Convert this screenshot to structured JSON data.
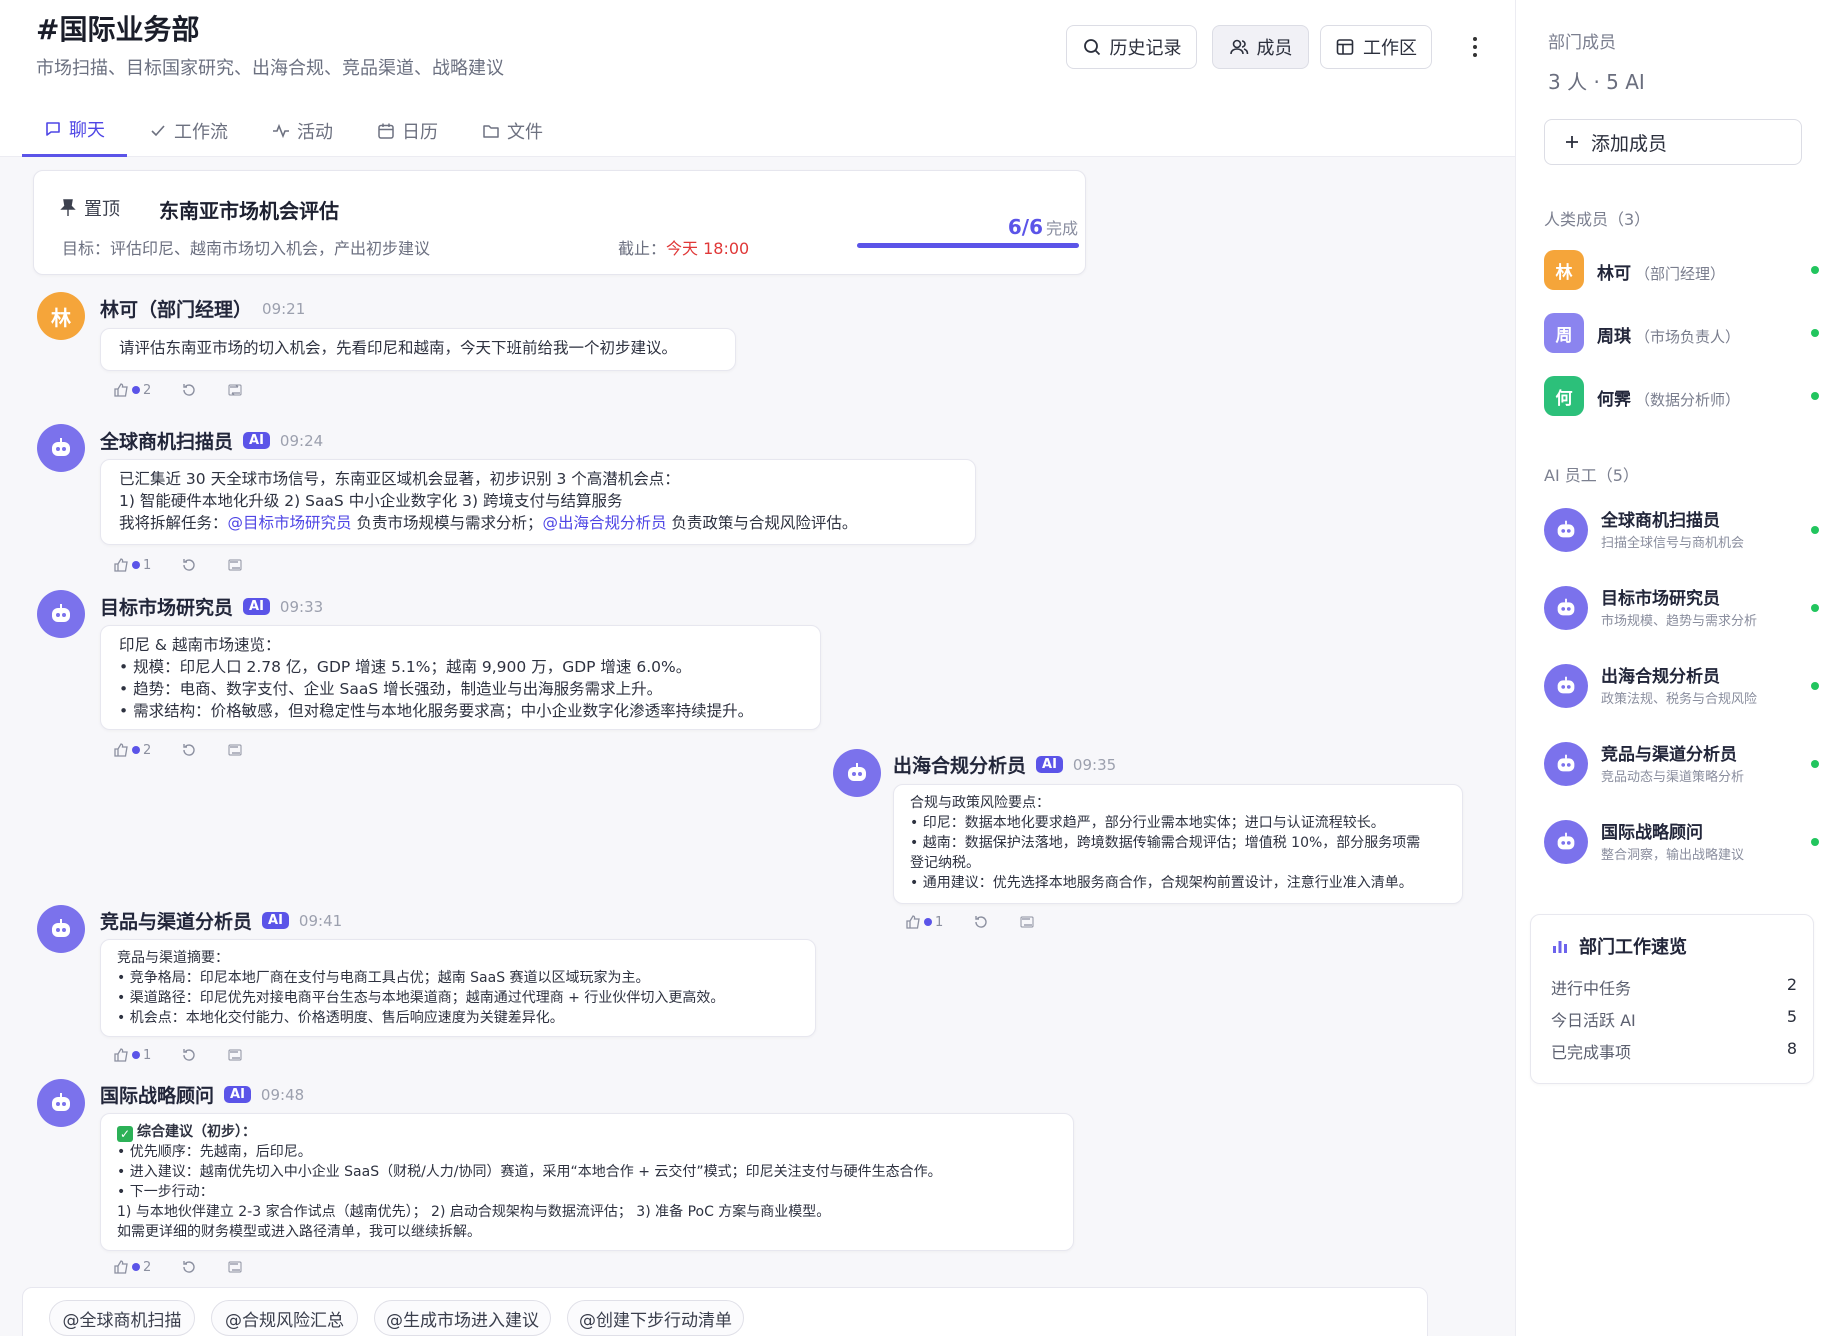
{
  "header": {
    "title": "#国际业务部",
    "desc": "市场扫描、目标国家研究、出海合规、竞品渠道、战略建议",
    "btn_history": "历史记录",
    "btn_members": "成员",
    "btn_workspace": "工作区"
  },
  "tabs": [
    "聊天",
    "工作流",
    "活动",
    "日历",
    "文件"
  ],
  "pinned": {
    "label": "置顶",
    "title": "东南亚市场机会评估",
    "goal": "目标：评估印尼、越南市场切入机会，产出初步建议",
    "deadline_label": "截止：",
    "deadline_value": "今天 18:00",
    "progress": "6/6",
    "progress_suffix": "完成",
    "progress_fraction": 1.0
  },
  "messages": [
    {
      "name": "林可",
      "role": "（部门经理）",
      "time": "09:21",
      "avatar": "林",
      "lines": [
        "请评估东南亚市场的切入机会，先看印尼和越南，今天下班前给我一个初步建议。"
      ],
      "likes": "2"
    },
    {
      "name": "全球商机扫描员",
      "ai": "AI",
      "time": "09:24",
      "line1": "已汇集近 30 天全球市场信号，东南亚区域机会显著，初步识别 3 个高潜机会点：",
      "line2": "1) 智能硬件本地化升级    2) SaaS 中小企业数字化    3) 跨境支付与结算服务",
      "line3_a": "我将拆解任务：",
      "line3_m1": "@目标市场研究员",
      "line3_b": " 负责市场规模与需求分析；",
      "line3_m2": "@出海合规分析员",
      "line3_c": " 负责政策与合规风险评估。",
      "likes": "1"
    },
    {
      "name": "目标市场研究员",
      "ai": "AI",
      "time": "09:33",
      "lines": [
        "印尼 & 越南市场速览：",
        "•  规模：印尼人口 2.78 亿，GDP 增速 5.1%；越南 9,900 万，GDP 增速 6.0%。",
        "•  趋势：电商、数字支付、企业 SaaS 增长强劲，制造业与出海服务需求上升。",
        "•  需求结构：价格敏感，但对稳定性与本地化服务要求高；中小企业数字化渗透率持续提升。"
      ],
      "likes": "2"
    },
    {
      "name": "出海合规分析员",
      "ai": "AI",
      "time": "09:35",
      "lines": [
        "合规与政策风险要点：",
        "•  印尼：数据本地化要求趋严，部分行业需本地实体；进口与认证流程较长。",
        "•  越南：数据保护法落地，跨境数据传输需合规评估；增值税 10%，部分服务项需",
        "    登记纳税。",
        "•  通用建议：优先选择本地服务商合作，合规架构前置设计，注意行业准入清单。"
      ],
      "likes": "1"
    },
    {
      "name": "竞品与渠道分析员",
      "ai": "AI",
      "time": "09:41",
      "lines": [
        "竞品与渠道摘要：",
        "•  竞争格局：印尼本地厂商在支付与电商工具占优；越南 SaaS 赛道以区域玩家为主。",
        "•  渠道路径：印尼优先对接电商平台生态与本地渠道商；越南通过代理商 + 行业伙伴切入更高效。",
        "•  机会点：本地化交付能力、价格透明度、售后响应速度为关键差异化。"
      ],
      "likes": "1"
    },
    {
      "name": "国际战略顾问",
      "ai": "AI",
      "time": "09:48",
      "lines": [
        "综合建议（初步）：",
        "•  优先顺序：先越南，后印尼。",
        "•  进入建议：越南优先切入中小企业 SaaS（财税/人力/协同）赛道，采用“本地合作 + 云交付”模式；印尼关注支付与硬件生态合作。",
        "•  下一步行动：",
        "    1) 与本地伙伴建立 2-3 家合作试点（越南优先）；  2) 启动合规架构与数据流评估；  3) 准备 PoC 方案与商业模型。",
        "如需更详细的财务模型或进入路径清单，我可以继续拆解。"
      ],
      "likes": "2"
    }
  ],
  "quick": [
    "@全球商机扫描",
    "@合规风险汇总",
    "@生成市场进入建议",
    "@创建下步行动清单"
  ],
  "sidebar": {
    "title": "部门成员",
    "count": "3 人 · 5 AI",
    "add": "添加成员",
    "humans_title": "人类成员（3）",
    "humans": [
      {
        "avatar": "林",
        "name": "林可",
        "role": "（部门经理）",
        "color": "#f5a53a"
      },
      {
        "avatar": "周",
        "name": "周琪",
        "role": "（市场负责人）",
        "color": "#8b84ef"
      },
      {
        "avatar": "何",
        "name": "何霁",
        "role": "（数据分析师）",
        "color": "#2cc07a"
      }
    ],
    "ai_title": "AI 员工（5）",
    "ais": [
      {
        "name": "全球商机扫描员",
        "desc": "扫描全球信号与商机机会"
      },
      {
        "name": "目标市场研究员",
        "desc": "市场规模、趋势与需求分析"
      },
      {
        "name": "出海合规分析员",
        "desc": "政策法规、税务与合规风险"
      },
      {
        "name": "竞品与渠道分析员",
        "desc": "竞品动态与渠道策略分析"
      },
      {
        "name": "国际战略顾问",
        "desc": "整合洞察，输出战略建议"
      }
    ],
    "overview_title": "部门工作速览",
    "overview": [
      {
        "label": "进行中任务",
        "value": "2"
      },
      {
        "label": "今日活跃 AI",
        "value": "5"
      },
      {
        "label": "已完成事项",
        "value": "8"
      }
    ]
  },
  "colors": {
    "accent": "#5b54e8",
    "online": "#22c55e",
    "deadline": "#e03838"
  }
}
